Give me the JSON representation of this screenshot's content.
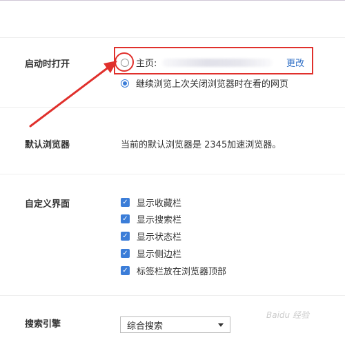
{
  "startup": {
    "title": "启动时打开",
    "homepage_label": "主页:",
    "change_link": "更改",
    "continue_label": "继续浏览上次关闭浏览器时在看的网页"
  },
  "default_browser": {
    "title": "默认浏览器",
    "status_text": "当前的默认浏览器是 2345加速浏览器。"
  },
  "customize": {
    "title": "自定义界面",
    "options": [
      {
        "label": "显示收藏栏",
        "checked": true
      },
      {
        "label": "显示搜索栏",
        "checked": true
      },
      {
        "label": "显示状态栏",
        "checked": true
      },
      {
        "label": "显示侧边栏",
        "checked": true
      },
      {
        "label": "标签栏放在浏览器顶部",
        "checked": true
      }
    ]
  },
  "search": {
    "title": "搜索引擎",
    "selected": "综合搜索"
  },
  "annotation_color": "#e0302c",
  "watermark": "Baidu 经验"
}
